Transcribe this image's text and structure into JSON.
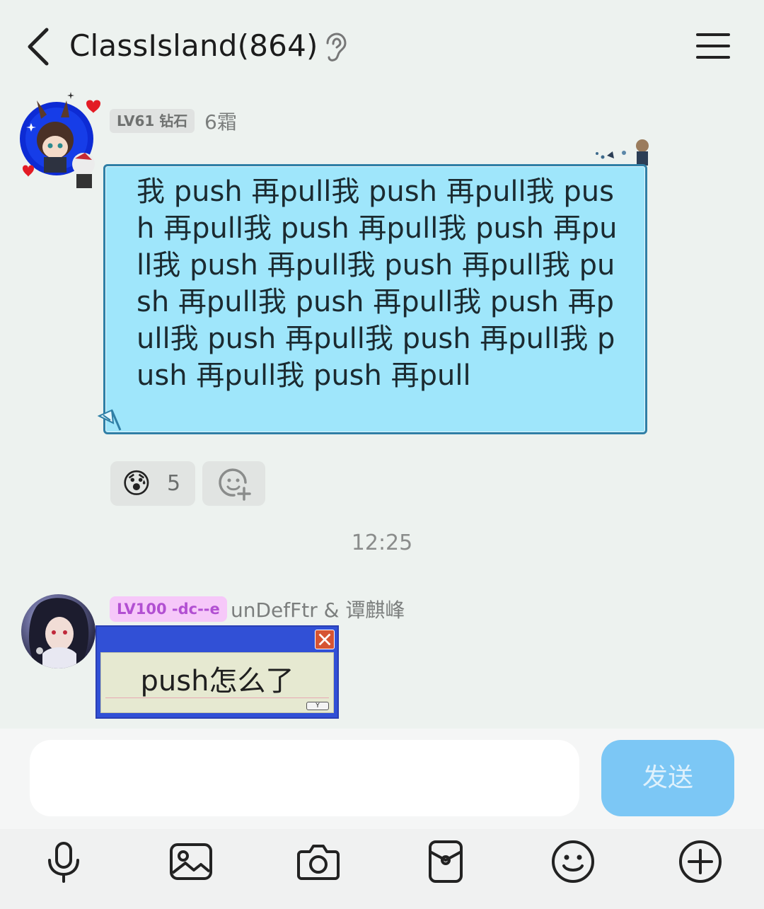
{
  "header": {
    "title": "ClassIsland(864)"
  },
  "messages": [
    {
      "badge": "LV61 钻石",
      "sender": "6霜",
      "text": "我 push 再pull我 push 再pull我 push 再pull我 push 再pull我 push 再pull我 push 再pull我 push 再pull我 push 再pull我 push 再pull我 push 再pull我 push 再pull我 push 再pull我 push 再pull我 push 再pull",
      "reactions": [
        {
          "emoji": "😰",
          "count": "5"
        }
      ]
    },
    {
      "badge": "LV100 -dc--e",
      "sender": "unDefFtr & 谭麒峰",
      "text": "push怎么了",
      "button_label": "Y"
    }
  ],
  "timestamp": "12:25",
  "input": {
    "placeholder": "",
    "send_label": "发送"
  },
  "toolbar": {
    "icons": [
      "microphone-icon",
      "image-icon",
      "camera-icon",
      "red-packet-icon",
      "emoji-icon",
      "plus-icon"
    ]
  },
  "colors": {
    "bubble": "#9fe6fb",
    "send_button": "#7cc7f5",
    "level_badge_2": "#f6c8f9"
  }
}
